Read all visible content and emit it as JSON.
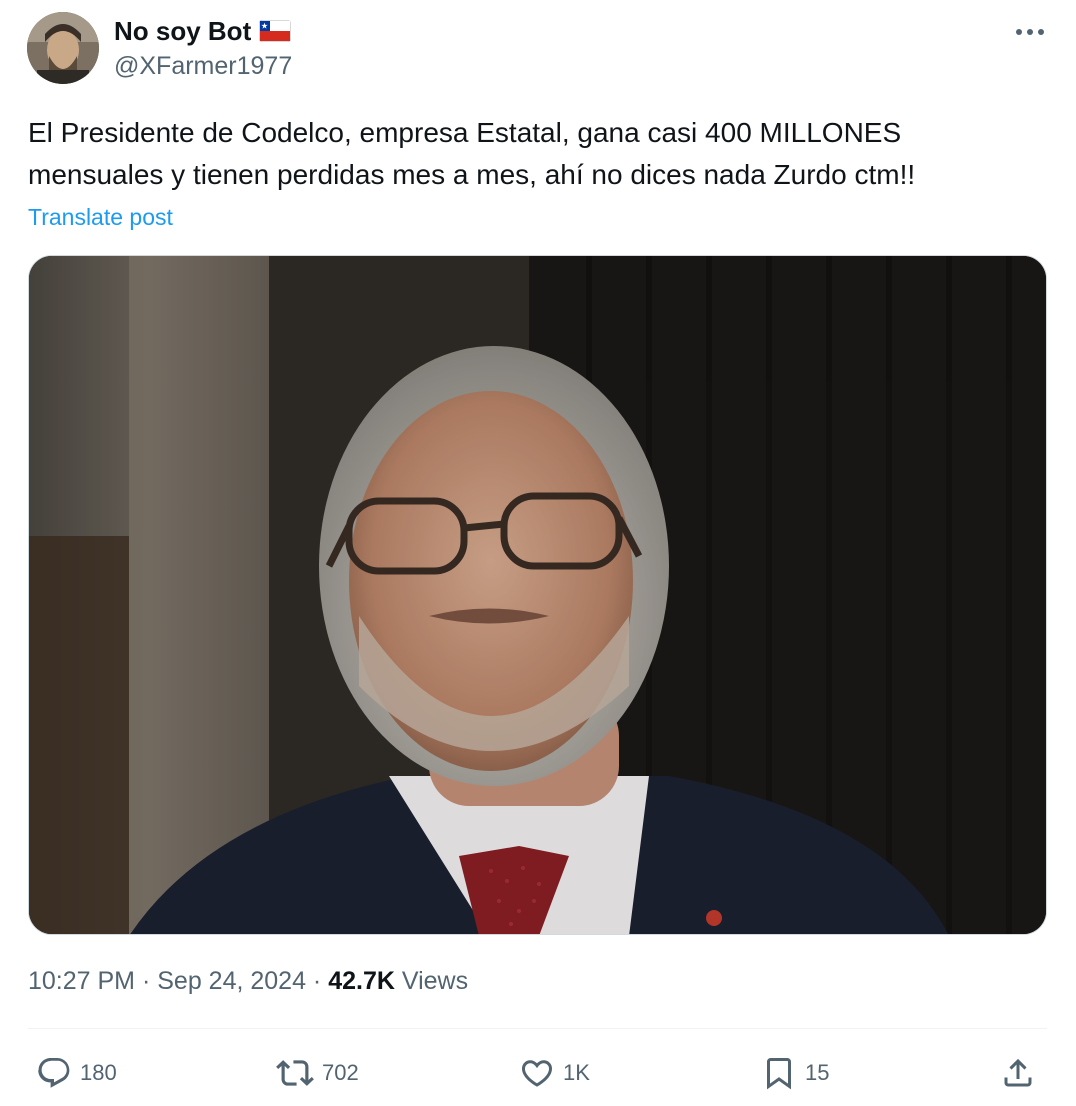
{
  "user": {
    "display_name": "No soy Bot",
    "flag": "chile-flag-icon",
    "handle": "@XFarmer1977"
  },
  "tweet": {
    "text": "El Presidente de Codelco, empresa Estatal, gana casi 400 MILLONES mensuales y tienen perdidas mes a mes, ahí no dices nada Zurdo ctm!!",
    "translate_label": "Translate post"
  },
  "meta": {
    "time": "10:27 PM",
    "separator": " · ",
    "date": "Sep 24, 2024",
    "views_count": "42.7K",
    "views_label": "Views"
  },
  "actions": {
    "replies": "180",
    "reposts": "702",
    "likes": "1K",
    "bookmarks": "15"
  },
  "colors": {
    "text_primary": "#0f1419",
    "text_secondary": "#536471",
    "link": "#1d9bf0",
    "divider": "#eff3f4"
  }
}
